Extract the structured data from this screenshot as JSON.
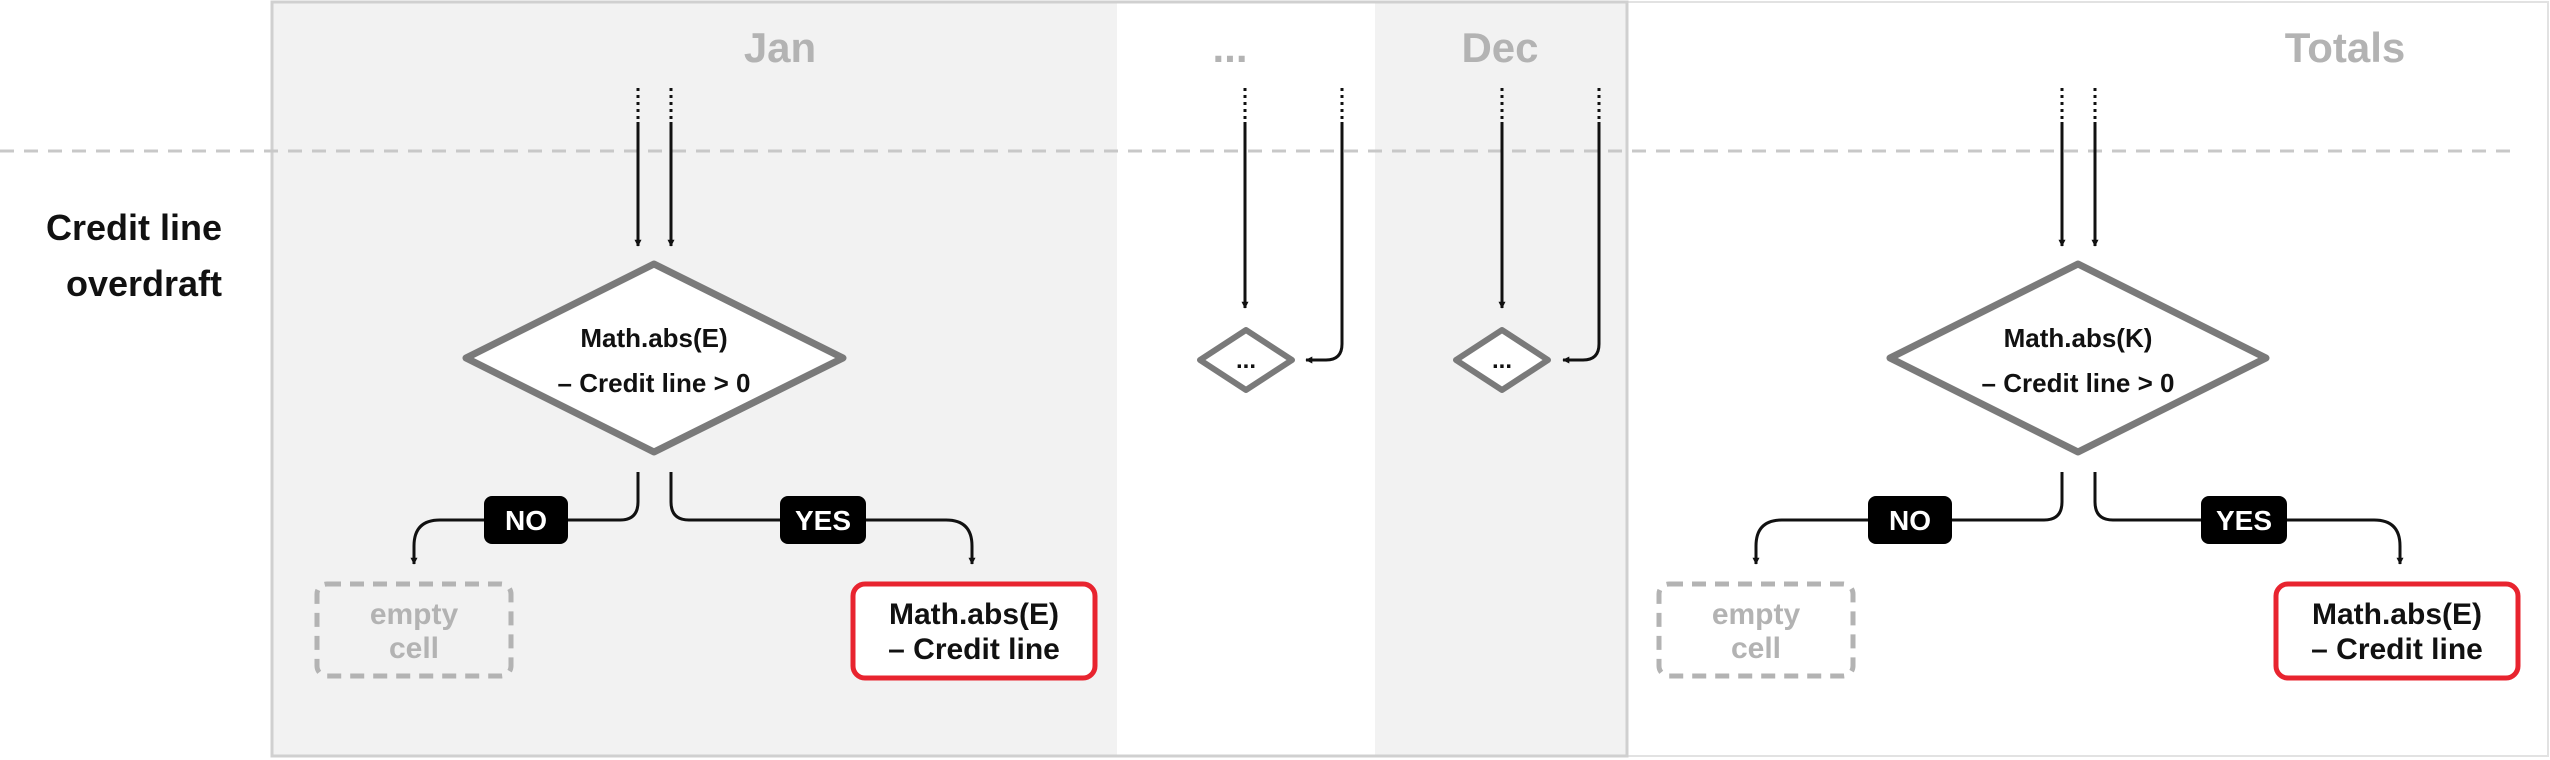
{
  "columns": {
    "jan": "Jan",
    "ellipsis": "...",
    "dec": "Dec",
    "totals": "Totals"
  },
  "row_label": {
    "line1": "Credit line",
    "line2": "overdraft"
  },
  "jan_flow": {
    "condition_line1": "Math.abs(E)",
    "condition_line2": "– Credit line > 0",
    "no_label": "NO",
    "yes_label": "YES",
    "no_result_line1": "empty",
    "no_result_line2": "cell",
    "yes_result_line1": "Math.abs(E)",
    "yes_result_line2": "– Credit line"
  },
  "ellipsis_flow": {
    "diamond_text": "..."
  },
  "dec_flow": {
    "diamond_text": "..."
  },
  "totals_flow": {
    "condition_line1": "Math.abs(K)",
    "condition_line2": "– Credit line > 0",
    "no_label": "NO",
    "yes_label": "YES",
    "no_result_line1": "empty",
    "no_result_line2": "cell",
    "yes_result_line1": "Math.abs(E)",
    "yes_result_line2": "– Credit line"
  },
  "colors": {
    "panel_bg": "#f2f2f2",
    "panel_border": "#d0d0d0",
    "diamond_stroke": "#7a7a7a",
    "arrow": "#111111",
    "pill_bg": "#000000",
    "highlight_red": "#e8242f",
    "muted_text": "#b3b3b3",
    "dashed_box": "#b3b3b3"
  }
}
